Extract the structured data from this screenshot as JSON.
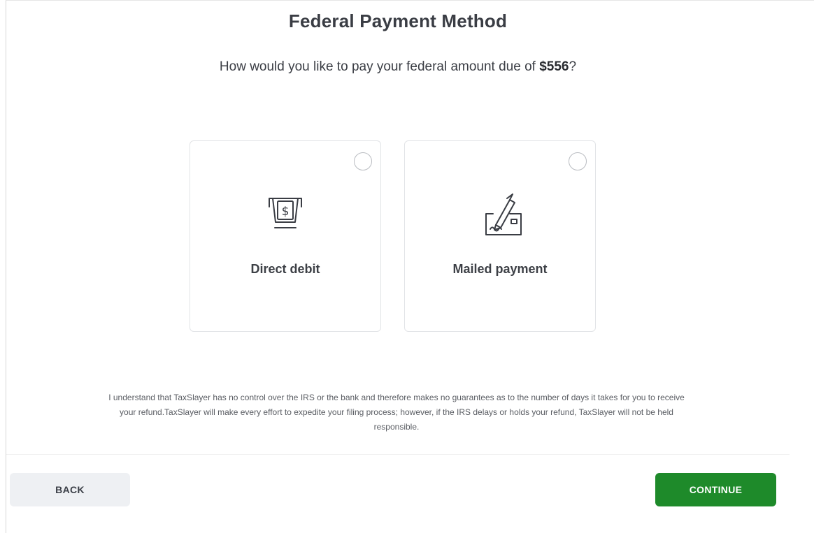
{
  "header": {
    "title": "Federal Payment Method",
    "question_prefix": "How would you like to pay your federal amount due of ",
    "amount": "$556",
    "question_suffix": "?"
  },
  "options": [
    {
      "label": "Direct debit",
      "icon": "atm-dollar-icon",
      "selected": false
    },
    {
      "label": "Mailed payment",
      "icon": "pen-check-icon",
      "selected": false
    }
  ],
  "disclaimer": {
    "line1": "I understand that TaxSlayer has no control over the IRS or the bank and therefore makes no guarantees as to the number of days it takes for you to receive",
    "line2": "your refund.TaxSlayer will make every effort to expedite your filing process; however, if the IRS delays or holds your refund, TaxSlayer will not be held",
    "line3": "responsible."
  },
  "footer": {
    "back_label": "BACK",
    "continue_label": "CONTINUE"
  },
  "colors": {
    "continue_bg": "#1e8a2a",
    "back_bg": "#eef0f3",
    "text": "#3a3d44"
  }
}
